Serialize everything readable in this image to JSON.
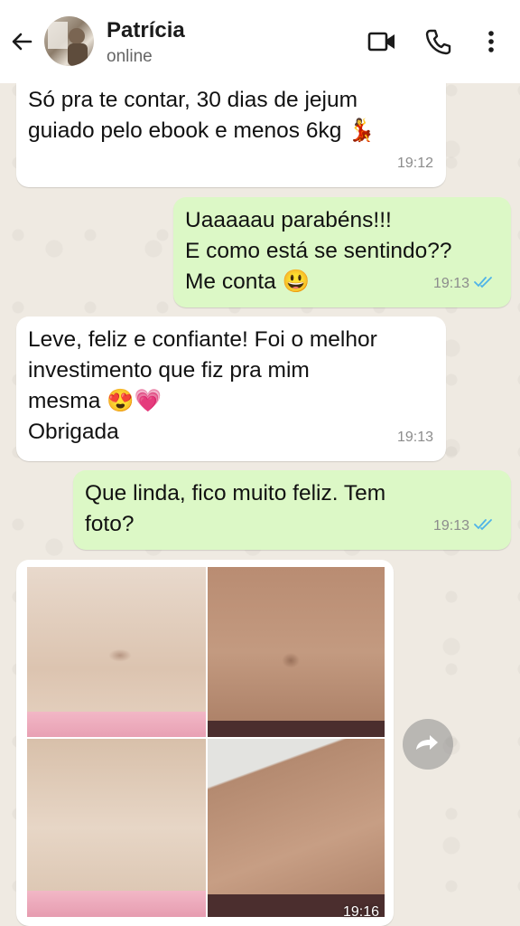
{
  "header": {
    "contact_name": "Patrícia",
    "status": "online"
  },
  "messages": [
    {
      "direction": "in",
      "text": "Só pra te contar, 30 dias de jejum\nguiado pelo ebook e menos 6kg 💃",
      "time": "19:12"
    },
    {
      "direction": "out",
      "text": "Uaaaaau parabéns!!!\nE como está se sentindo??\nMe conta 😃",
      "time": "19:13",
      "read": true
    },
    {
      "direction": "in",
      "text": "Leve, feliz e confiante! Foi o melhor\ninvestimento que fiz pra mim\nmesma 😍💗\nObrigada",
      "time": "19:13"
    },
    {
      "direction": "out",
      "text": "Que linda, fico muito feliz. Tem\nfoto?",
      "time": "19:13",
      "read": true
    },
    {
      "direction": "in",
      "type": "image",
      "time": "19:16"
    }
  ],
  "colors": {
    "incoming_bubble": "#ffffff",
    "outgoing_bubble": "#dcf8c6",
    "read_ticks": "#4fb3e8",
    "chat_background": "#efeae2"
  },
  "icons": [
    "back-arrow-icon",
    "video-call-icon",
    "phone-icon",
    "more-options-icon",
    "double-check-icon",
    "forward-icon"
  ]
}
